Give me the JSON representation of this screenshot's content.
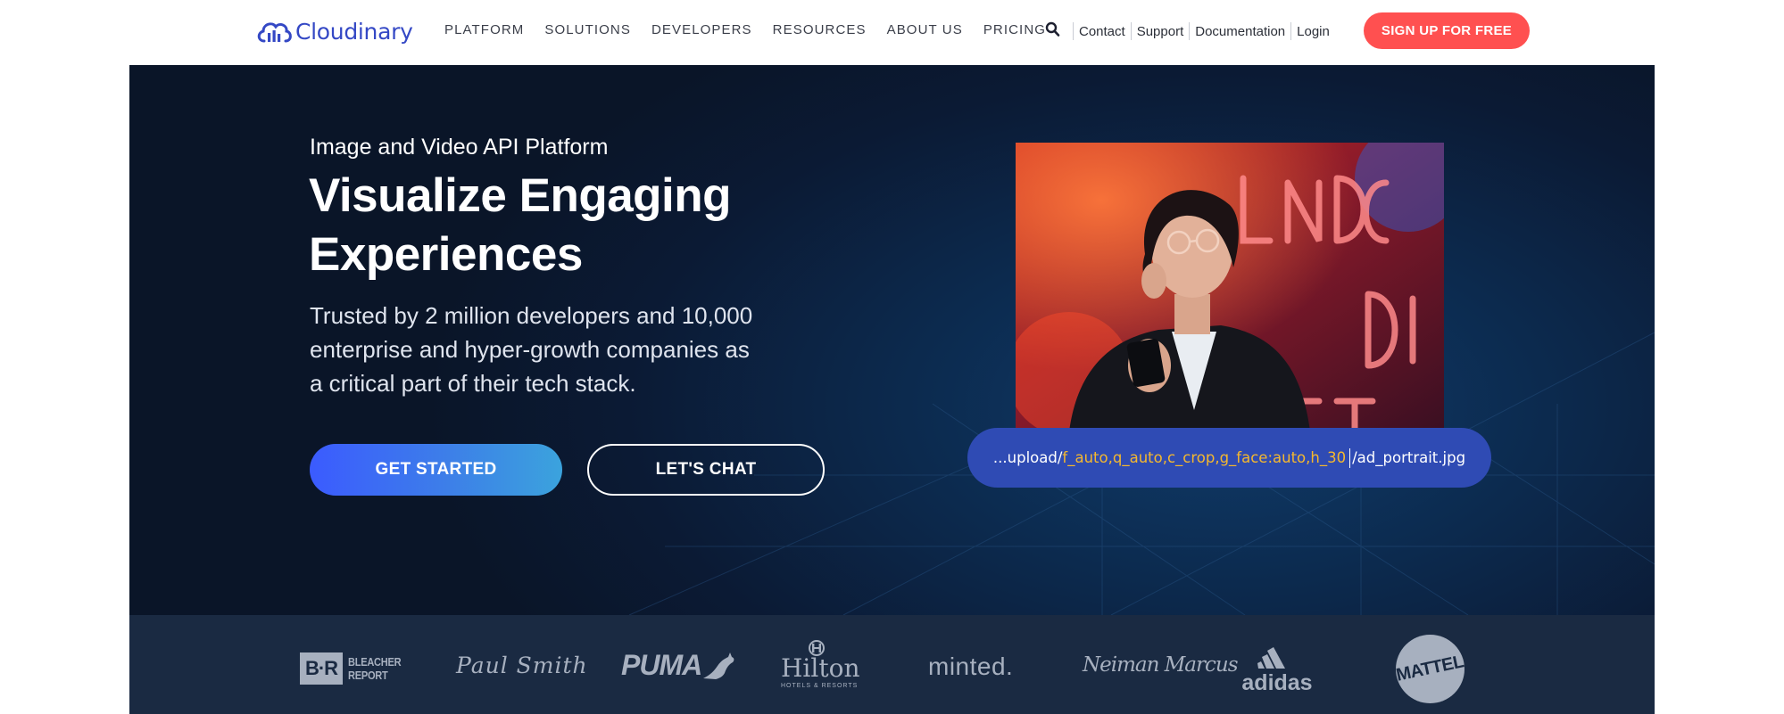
{
  "nav": {
    "logo_text": "Cloudinary",
    "menu": [
      "PLATFORM",
      "SOLUTIONS",
      "DEVELOPERS",
      "RESOURCES",
      "ABOUT US",
      "PRICING"
    ],
    "search_icon": "search-icon",
    "utility": [
      "Contact",
      "Support",
      "Documentation",
      "Login"
    ],
    "signup_label": "SIGN UP FOR FREE"
  },
  "hero": {
    "eyebrow": "Image and Video API Platform",
    "headline": [
      "Visualize Engaging",
      "Experiences"
    ],
    "subtitle": [
      "Trusted by 2 million developers and 10,000",
      "enterprise and hyper-growth companies as",
      "a critical part of their tech stack."
    ],
    "cta_primary": "GET STARTED",
    "cta_secondary": "LET'S CHAT",
    "url": {
      "prefix": "...upload/",
      "transform": "f_auto,q_auto,c_crop,g_face:auto,h_30",
      "suffix": "/ad_portrait.jpg"
    }
  },
  "logos": {
    "bleacher_box": "B·R",
    "bleacher_words": [
      "BLEACHER",
      "REPORT"
    ],
    "paul_smith": "Paul Smith",
    "puma": "PUMA",
    "hilton": "Hilton",
    "hilton_sub": "HOTELS & RESORTS",
    "minted": "minted.",
    "neiman": "Neiman Marcus",
    "adidas": "adidas",
    "mattel": "MATTEL"
  },
  "colors": {
    "brand_blue": "#3448c5",
    "signup_red": "#ff5050",
    "hero_bg": "#0b1a34",
    "url_pill": "#2f4bb4",
    "url_highlight": "#f5b82e",
    "logo_strip": "#1a2a42"
  }
}
